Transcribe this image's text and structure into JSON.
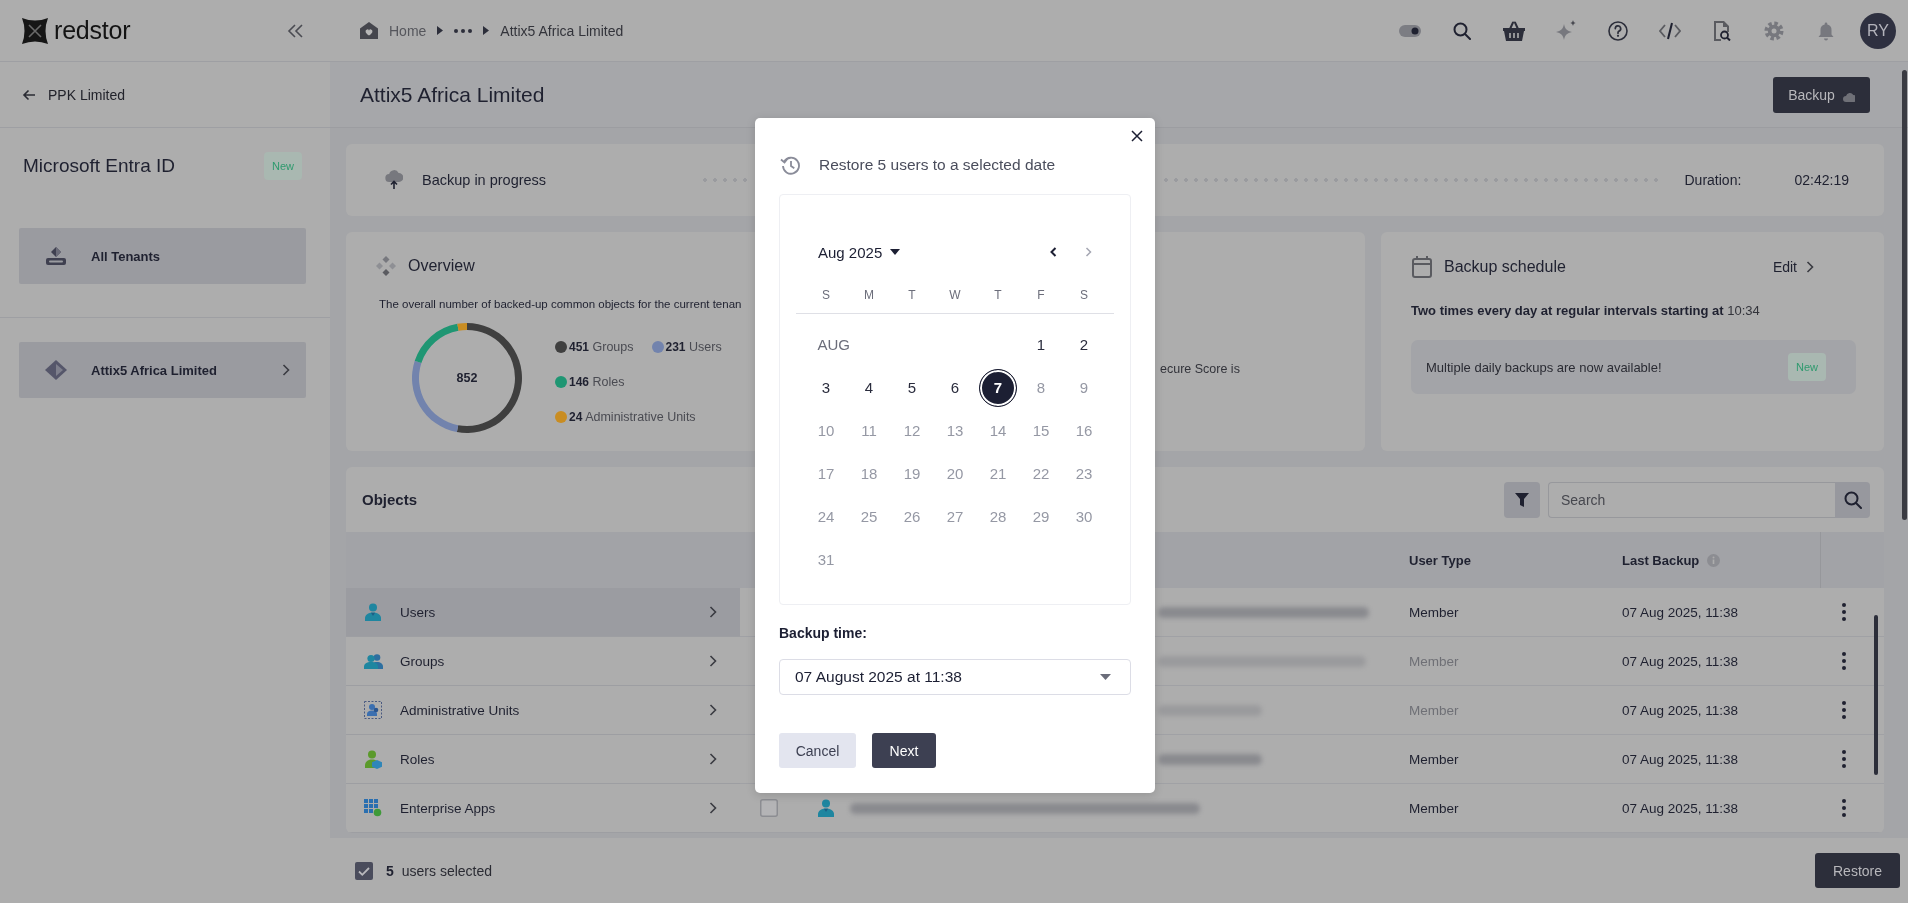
{
  "topbar": {
    "logo": "redstor",
    "breadcrumb": [
      {
        "kind": "home",
        "label": "Home"
      },
      {
        "kind": "ellipsis"
      },
      {
        "kind": "page",
        "label": "Attix5 Africa Limited"
      }
    ],
    "avatar": "RY"
  },
  "sidebar": {
    "back": "PPK Limited",
    "title": "Microsoft Entra ID",
    "badge": "New",
    "all_tenants": "All Tenants",
    "tenants": [
      {
        "label": "Attix5 Africa Limited"
      }
    ]
  },
  "page_header": {
    "title": "Attix5 Africa Limited",
    "action": "Backup"
  },
  "backup_status": {
    "label": "Backup in progress",
    "duration_label": "Duration:",
    "duration": "02:42:19"
  },
  "overview": {
    "title": "Overview",
    "description": "The overall number of backed-up common objects for the current tenan",
    "total": "852",
    "legend": [
      {
        "color": "#3f3f3f"
      },
      {
        "color": "#7283ad"
      },
      {
        "color": "#1f9673"
      },
      {
        "color": "#c98d22"
      }
    ],
    "chart_data": {
      "type": "donut",
      "categories": [
        "Groups",
        "Users",
        "Roles",
        "Administrative Units"
      ],
      "values": [
        451,
        231,
        146,
        24
      ],
      "value_labels": [
        "451",
        "231",
        "146",
        "24"
      ],
      "legend": "right"
    }
  },
  "card_2": {
    "text": "ecure Score is"
  },
  "backup_schedule": {
    "title": "Backup schedule",
    "edit": "Edit",
    "summary": "**Two times every day at regular intervals starting at** 10:34",
    "notice": "Multiple daily backups are now available!",
    "notice_badge": "New"
  },
  "objects": {
    "title": "Objects",
    "search": {
      "placeholder": "Search"
    },
    "types": [
      {
        "kind": "user",
        "label": "Users",
        "selected": true
      },
      {
        "kind": "group",
        "label": "Groups",
        "selected": false
      },
      {
        "kind": "admin_unit",
        "label": "Administrative Units",
        "selected": false
      },
      {
        "kind": "role",
        "label": "Roles",
        "selected": false
      },
      {
        "kind": "app",
        "label": "Enterprise Apps",
        "selected": false
      }
    ],
    "columns": [
      {
        "label": "User Type",
        "info": false
      },
      {
        "label": "Last Backup",
        "info": true
      }
    ],
    "rows": [
      {
        "user_type": "Member",
        "last_backup": "07 Aug 2025, 11:38",
        "greyed": false
      },
      {
        "user_type": "Member",
        "last_backup": "07 Aug 2025, 11:38",
        "greyed": true
      },
      {
        "user_type": "Member",
        "last_backup": "07 Aug 2025, 11:38",
        "greyed": true
      },
      {
        "user_type": "Member",
        "last_backup": "07 Aug 2025, 11:38",
        "greyed": false
      },
      {
        "checked": false,
        "user_type": "Member",
        "last_backup": "07 Aug 2025, 11:38",
        "greyed": false
      }
    ]
  },
  "selection_bar": {
    "checked": true,
    "count": "5",
    "label": "users selected",
    "action": "Restore"
  },
  "modal": {
    "title": "Restore 5 users to a selected date",
    "calendar": {
      "month": "Aug 2025",
      "nav": [
        {
          "kind": "prev",
          "disabled": false
        },
        {
          "kind": "next",
          "disabled": true
        }
      ],
      "weekdays": [
        "S",
        "M",
        "T",
        "W",
        "T",
        "F",
        "S"
      ],
      "weeks": [
        {
          "label": "AUG",
          "days": [
            {
              "day": "1",
              "disabled": false,
              "selected": false
            },
            {
              "day": "2",
              "disabled": false,
              "selected": false
            }
          ]
        },
        {
          "days": [
            {
              "day": "3",
              "disabled": false,
              "selected": false
            },
            {
              "day": "4",
              "disabled": false,
              "selected": false
            },
            {
              "day": "5",
              "disabled": false,
              "selected": false
            },
            {
              "day": "6",
              "disabled": false,
              "selected": false
            },
            {
              "day": "7",
              "disabled": false,
              "selected": true
            },
            {
              "day": "8",
              "disabled": true,
              "selected": false
            },
            {
              "day": "9",
              "disabled": true,
              "selected": false
            }
          ]
        },
        {
          "days": [
            {
              "day": "10",
              "disabled": true,
              "selected": false
            },
            {
              "day": "11",
              "disabled": true,
              "selected": false
            },
            {
              "day": "12",
              "disabled": true,
              "selected": false
            },
            {
              "day": "13",
              "disabled": true,
              "selected": false
            },
            {
              "day": "14",
              "disabled": true,
              "selected": false
            },
            {
              "day": "15",
              "disabled": true,
              "selected": false
            },
            {
              "day": "16",
              "disabled": true,
              "selected": false
            }
          ]
        },
        {
          "days": [
            {
              "day": "17",
              "disabled": true,
              "selected": false
            },
            {
              "day": "18",
              "disabled": true,
              "selected": false
            },
            {
              "day": "19",
              "disabled": true,
              "selected": false
            },
            {
              "day": "20",
              "disabled": true,
              "selected": false
            },
            {
              "day": "21",
              "disabled": true,
              "selected": false
            },
            {
              "day": "22",
              "disabled": true,
              "selected": false
            },
            {
              "day": "23",
              "disabled": true,
              "selected": false
            }
          ]
        },
        {
          "days": [
            {
              "day": "24",
              "disabled": true,
              "selected": false
            },
            {
              "day": "25",
              "disabled": true,
              "selected": false
            },
            {
              "day": "26",
              "disabled": true,
              "selected": false
            },
            {
              "day": "27",
              "disabled": true,
              "selected": false
            },
            {
              "day": "28",
              "disabled": true,
              "selected": false
            },
            {
              "day": "29",
              "disabled": true,
              "selected": false
            },
            {
              "day": "30",
              "disabled": true,
              "selected": false
            }
          ]
        },
        {
          "days": [
            {
              "day": "31",
              "disabled": true,
              "selected": false
            }
          ]
        }
      ]
    },
    "time_label": "Backup time:",
    "time_value": "07 August 2025 at 11:38",
    "buttons": [
      {
        "kind": "secondary",
        "label": "Cancel"
      },
      {
        "kind": "primary",
        "label": "Next"
      }
    ]
  }
}
